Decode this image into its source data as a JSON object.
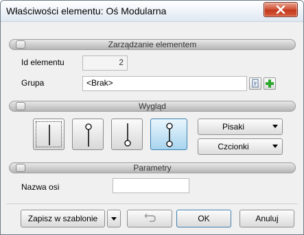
{
  "window": {
    "title": "Właściwości elementu: Oś Modularna"
  },
  "sections": {
    "management": {
      "title": "Zarządzanie elementem"
    },
    "appearance": {
      "title": "Wygląd"
    },
    "parameters": {
      "title": "Parametry"
    }
  },
  "management": {
    "id_label": "Id elementu",
    "id_value": "2",
    "group_label": "Grupa",
    "group_value": "<Brak>"
  },
  "appearance": {
    "styles": [
      {
        "name": "plain-line",
        "selected": false
      },
      {
        "name": "top-circle-line",
        "selected": false
      },
      {
        "name": "bottom-circle-line",
        "selected": false
      },
      {
        "name": "both-circles-line",
        "selected": true
      }
    ],
    "pens_button": "Pisaki",
    "fonts_button": "Czcionki"
  },
  "parameters": {
    "axis_name_label": "Nazwa osi",
    "axis_name_value": ""
  },
  "footer": {
    "save_template": "Zapisz w szablonie",
    "ok": "OK",
    "cancel": "Anuluj"
  },
  "icons": {
    "close": "close-icon",
    "collapse": "collapse-icon",
    "edit_group": "edit-group-icon",
    "add_group": "add-icon",
    "undo": "undo-icon"
  },
  "colors": {
    "close_button": "#c8452a",
    "selected_tile": "#a8d4ee",
    "add_icon": "#2da82d"
  }
}
